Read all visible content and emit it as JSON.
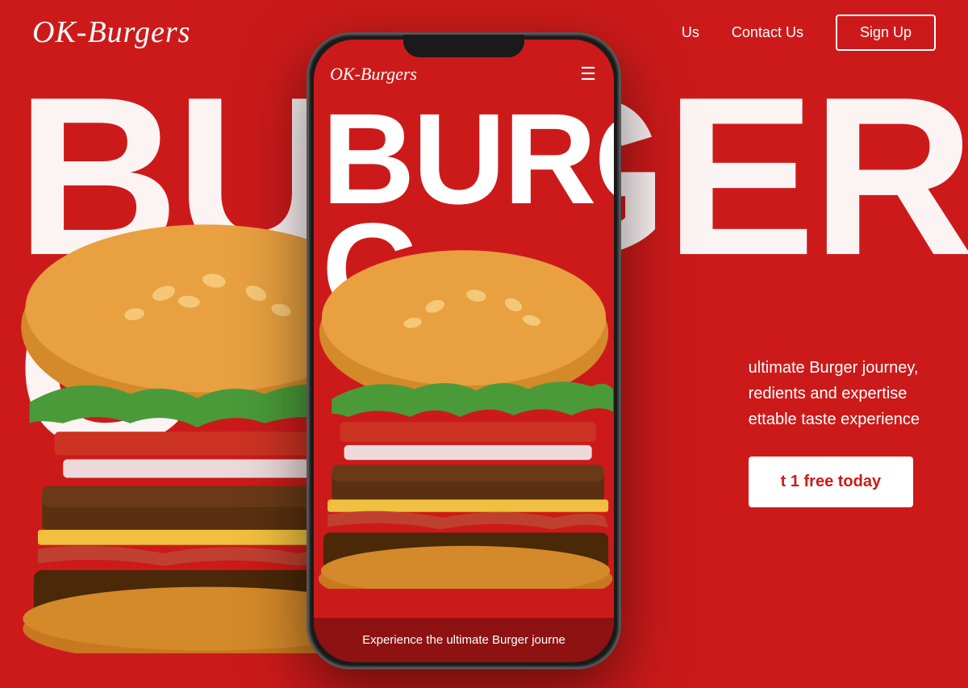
{
  "brand": {
    "name": "OK-Burgers",
    "logo_text": "OK-Burgers"
  },
  "navbar": {
    "logo": "OK-Burgers",
    "links": [
      {
        "id": "about",
        "label": "Us"
      },
      {
        "id": "contact",
        "label": "Contact Us"
      }
    ],
    "signup_label": "Sign Up"
  },
  "hero": {
    "big_text_line1": "BURGER",
    "big_text_line2": "G",
    "description_line1": "ultimate Burger journey,",
    "description_line2": "redients and expertise",
    "description_line3": "ettable taste experience",
    "cta_label": "t 1 free today"
  },
  "phone": {
    "logo": "OK-Burgers",
    "big_text": "BURGER",
    "bottom_text": "Experience the ultimate Burger journe"
  },
  "colors": {
    "background": "#cc1a1a",
    "text_white": "#ffffff",
    "button_bg": "#ffffff"
  }
}
